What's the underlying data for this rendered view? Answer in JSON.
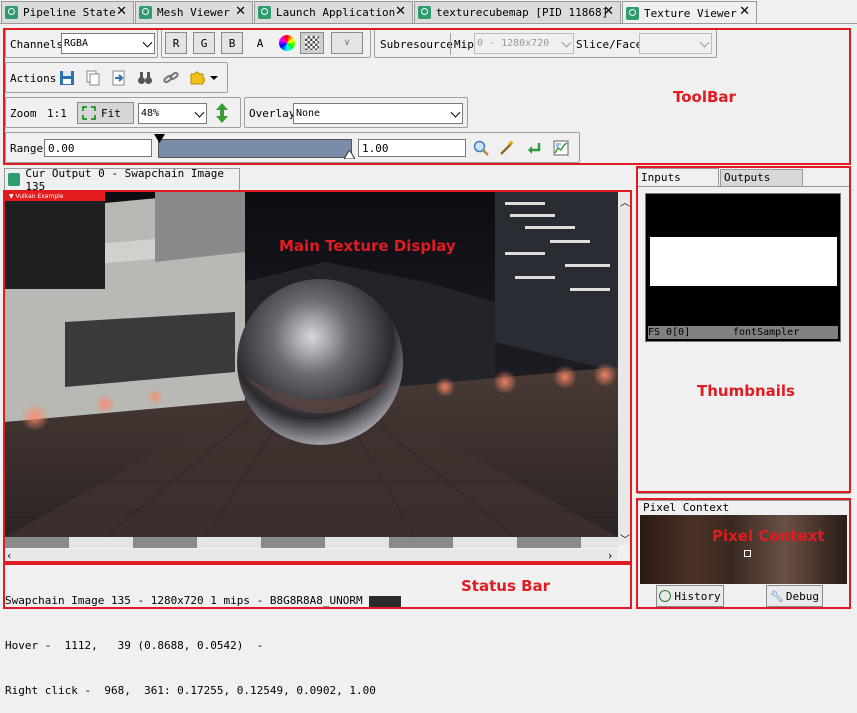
{
  "tabs": [
    {
      "label": "Pipeline State"
    },
    {
      "label": "Mesh Viewer"
    },
    {
      "label": "Launch Application"
    },
    {
      "label": "texturecubemap [PID 11868]"
    },
    {
      "label": "Texture Viewer"
    }
  ],
  "toolbar": {
    "channels_label": "Channels",
    "channels_value": "RGBA",
    "r": "R",
    "g": "G",
    "b": "B",
    "a": "A",
    "subresource_label": "Subresource",
    "mip_label": "Mip",
    "mip_value": "0 - 1280x720",
    "slice_label": "Slice/Face",
    "slice_value": "",
    "actions_label": "Actions",
    "zoom_label": "Zoom",
    "zoom_ratio": "1:1",
    "fit_label": "Fit",
    "zoom_value": "48%",
    "overlay_label": "Overlay",
    "overlay_value": "None",
    "range_label": "Range",
    "range_min": "0.00",
    "range_max": "1.00"
  },
  "texture_tab": {
    "label": "Cur Output 0 - Swapchain Image 135"
  },
  "overlay_window": {
    "title": "Vulkan Example"
  },
  "right_tabs": [
    {
      "label": "Inputs"
    },
    {
      "label": "Outputs"
    }
  ],
  "thumbnail": {
    "slot": "FS 0[0]",
    "name": "fontSampler"
  },
  "pixel_context": {
    "title": "Pixel Context",
    "history_label": "History",
    "debug_label": "Debug"
  },
  "status": {
    "line1": "Swapchain Image 135 - 1280x720 1 mips - B8G8R8A8_UNORM",
    "line2": "Hover -  1112,   39 (0.8688, 0.0542)  -",
    "line3": "Right click -  968,  361: 0.17255, 0.12549, 0.0902, 1.00"
  },
  "annotations": {
    "toolbar": "ToolBar",
    "main_texture": "Main Texture Display",
    "thumbnails": "Thumbnails",
    "pixel_context": "Pixel Context",
    "status_bar": "Status Bar"
  },
  "colors": {
    "annotation": "#e11b22",
    "tab_icon": "#2e9c6c"
  }
}
